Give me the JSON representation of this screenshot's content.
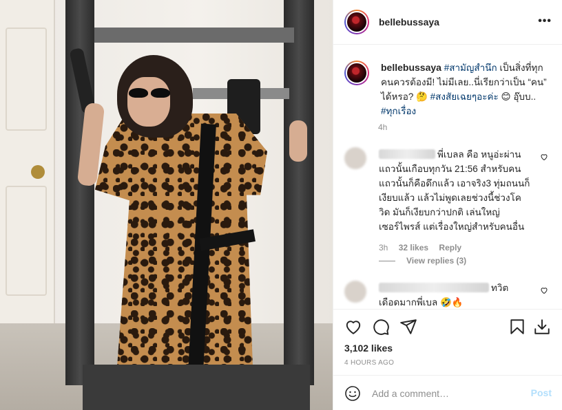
{
  "colors": {
    "link": "#00376b",
    "muted": "#8e8e8e",
    "text": "#262626",
    "post_disabled": "#b2dffc"
  },
  "header": {
    "username": "bellebussaya",
    "more_icon": "more-horizontal-icon"
  },
  "caption": {
    "username": "bellebussaya",
    "hashtag1": "#สามัญสำนึก",
    "text1": " เป็นสิ่งที่ทุกคนควรต้องมี! ไม่มีเลย..นี่เรียกว่าเป็น “คน” ได้หรอ? 🤔 ",
    "hashtag2": "#สงสัยเฉยๆอะค่ะ",
    "text2": " 😊 อุ๊บบ..",
    "hashtag3": "#ทุกเรื่อง",
    "time": "4h"
  },
  "comments": [
    {
      "text": "พี่เบลล คือ หนูอ่ะผ่านแถวนั้นเกือบทุกวัน 21:56 สำหรับคนแถวนั้นก็คือดึกแล้ว เอาจริง3 ทุ่มถนนก็เงียบแล้ว แล้วไม่พูดเลยช่วงนี้ช่วงโควิด มันก็เงียบกว่าปกติ เล่นใหญ่เซอร์ไพรส์ แต่เรื่องใหญ่สำหรับคนอื่น",
      "time": "3h",
      "likes": "32 likes",
      "reply": "Reply",
      "view_replies": "View replies (3)"
    },
    {
      "text": "ทวิต เดือดมากพี่เบล 🤣🔥"
    }
  ],
  "actions": {
    "icons": [
      "heart-icon",
      "comment-icon",
      "share-icon",
      "bookmark-icon",
      "download-icon"
    ],
    "likes": "3,102 likes",
    "time_ago": "4 HOURS AGO"
  },
  "add_comment": {
    "placeholder": "Add a comment…",
    "post_label": "Post",
    "emoji_icon": "emoji-icon"
  }
}
